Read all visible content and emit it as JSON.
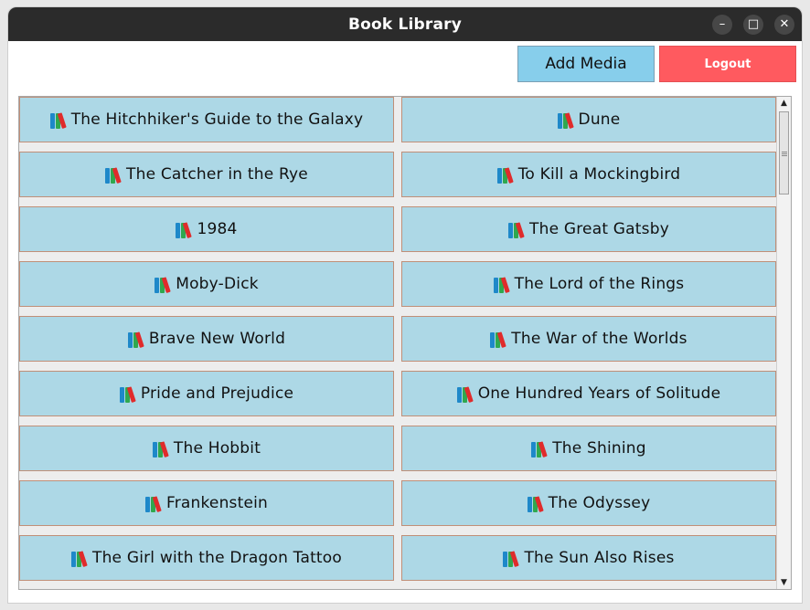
{
  "window": {
    "title": "Book Library",
    "controls": {
      "minimize": "–",
      "maximize": "□",
      "close": "✕"
    }
  },
  "toolbar": {
    "add_label": "Add Media",
    "add_color": "#87ceeb",
    "logout_label": "Logout",
    "logout_color": "#ff5a5f"
  },
  "books": [
    {
      "title": "The Hitchhiker's Guide to the Galaxy",
      "icon": "books-icon"
    },
    {
      "title": "Dune",
      "icon": "books-icon"
    },
    {
      "title": "The Catcher in the Rye",
      "icon": "books-icon"
    },
    {
      "title": "To Kill a Mockingbird",
      "icon": "books-icon"
    },
    {
      "title": "1984",
      "icon": "books-icon"
    },
    {
      "title": "The Great Gatsby",
      "icon": "books-icon"
    },
    {
      "title": "Moby-Dick",
      "icon": "books-icon"
    },
    {
      "title": "The Lord of the Rings",
      "icon": "books-icon"
    },
    {
      "title": "Brave New World",
      "icon": "books-icon"
    },
    {
      "title": "The War of the Worlds",
      "icon": "books-icon"
    },
    {
      "title": "Pride and Prejudice",
      "icon": "books-icon"
    },
    {
      "title": "One Hundred Years of Solitude",
      "icon": "books-icon"
    },
    {
      "title": "The Hobbit",
      "icon": "books-icon"
    },
    {
      "title": "The Shining",
      "icon": "books-icon"
    },
    {
      "title": "Frankenstein",
      "icon": "books-icon"
    },
    {
      "title": "The Odyssey",
      "icon": "books-icon"
    },
    {
      "title": "The Girl with the Dragon Tattoo",
      "icon": "books-icon"
    },
    {
      "title": "The Sun Also Rises",
      "icon": "books-icon"
    }
  ],
  "scrollbar": {
    "up_arrow": "▲",
    "down_arrow": "▼"
  }
}
